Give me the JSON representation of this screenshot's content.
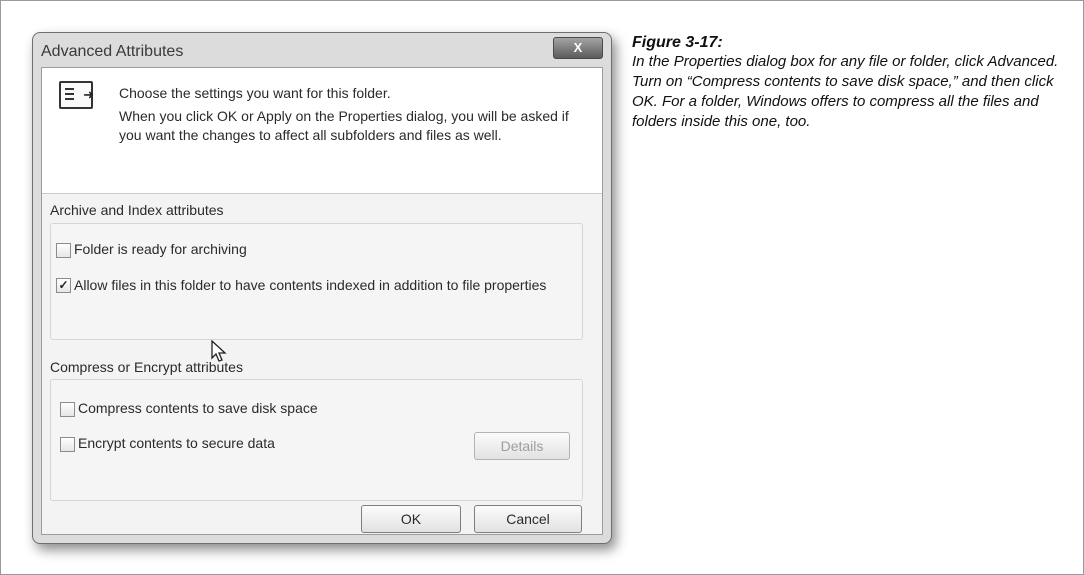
{
  "window": {
    "title": "Advanced Attributes",
    "close_label": "X"
  },
  "intro": {
    "line1": "Choose the settings you want for this folder.",
    "line2": "When you click OK or Apply on the Properties dialog, you will be asked if you want the changes to affect all subfolders and files as well."
  },
  "archive_group": {
    "title": "Archive and Index attributes",
    "items": [
      {
        "label": "Folder is ready for archiving",
        "checked": false
      },
      {
        "label": "Allow files in this folder to have contents indexed in addition to file properties",
        "checked": true
      }
    ]
  },
  "compress_group": {
    "title": "Compress or Encrypt attributes",
    "items": [
      {
        "label": "Compress contents to save disk space",
        "checked": false
      },
      {
        "label": "Encrypt contents to secure data",
        "checked": false
      }
    ],
    "details_label": "Details"
  },
  "buttons": {
    "ok": "OK",
    "cancel": "Cancel"
  },
  "caption": {
    "title": "Figure 3-17:",
    "text": "In the Properties dialog box for any file or folder, click Advanced. Turn on “Compress contents to save disk space,” and then click OK. For a folder, Windows offers to compress all the files and folders inside this one, too."
  }
}
